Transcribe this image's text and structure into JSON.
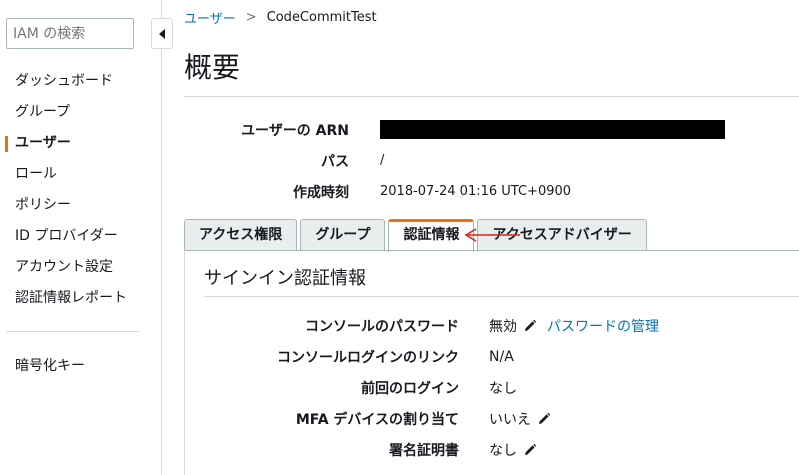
{
  "sidebar": {
    "search_placeholder": "IAM の検索",
    "items": [
      {
        "label": "ダッシュボード"
      },
      {
        "label": "グループ"
      },
      {
        "label": "ユーザー"
      },
      {
        "label": "ロール"
      },
      {
        "label": "ポリシー"
      },
      {
        "label": "ID プロバイダー"
      },
      {
        "label": "アカウント設定"
      },
      {
        "label": "認証情報レポート"
      }
    ],
    "active_item": "ユーザー",
    "secondary_items": [
      {
        "label": "暗号化キー"
      }
    ]
  },
  "breadcrumb": {
    "parent": "ユーザー",
    "separator": ">",
    "current": "CodeCommitTest"
  },
  "page": {
    "title": "概要"
  },
  "summary": {
    "arn_label": "ユーザーの ARN",
    "path_label": "パス",
    "path_value": "/",
    "created_label": "作成時刻",
    "created_value": "2018-07-24 01:16 UTC+0900"
  },
  "tabs": [
    {
      "label": "アクセス権限"
    },
    {
      "label": "グループ"
    },
    {
      "label": "認証情報"
    },
    {
      "label": "アクセスアドバイザー"
    }
  ],
  "active_tab": "認証情報",
  "signin": {
    "title": "サインイン認証情報",
    "rows": [
      {
        "label": "コンソールのパスワード",
        "value": "無効",
        "link": "パスワードの管理"
      },
      {
        "label": "コンソールログインのリンク",
        "value": "N/A"
      },
      {
        "label": "前回のログイン",
        "value": "なし"
      },
      {
        "label": "MFA デバイスの割り当て",
        "value": "いいえ"
      },
      {
        "label": "署名証明書",
        "value": "なし"
      }
    ]
  },
  "colors": {
    "accent": "#ec7211",
    "link": "#0073bb",
    "annotation_arrow": "#e0201b"
  }
}
